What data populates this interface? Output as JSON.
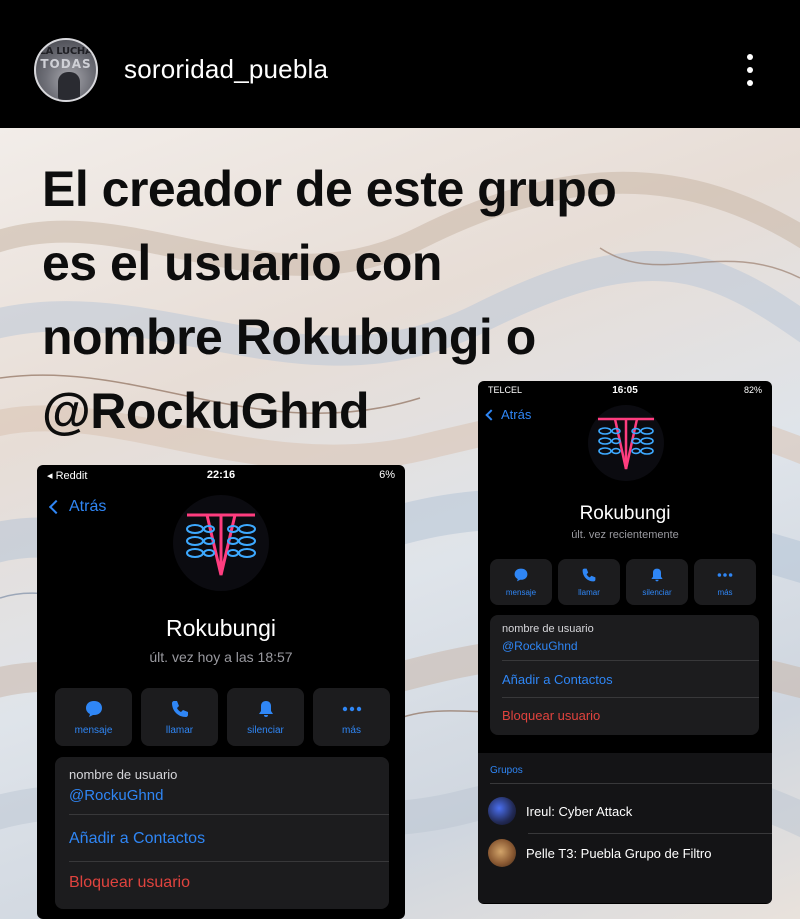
{
  "header": {
    "username": "sororidad_puebla",
    "avatar_text_line1": "LA LUCHA",
    "avatar_text_line2": "TODAS"
  },
  "headline": {
    "lines": [
      "El creador de este grupo",
      "es el usuario con",
      "nombre Rokubungi o",
      "@RockuGhnd"
    ]
  },
  "left_phone": {
    "status": {
      "carrier": "◂ Reddit",
      "time": "22:16",
      "battery": "6%"
    },
    "back_label": "Atrás",
    "name": "Rokubungi",
    "last_seen": "últ. vez hoy a las 18:57",
    "actions": [
      {
        "label": "mensaje",
        "icon": "chat-bubble-icon"
      },
      {
        "label": "llamar",
        "icon": "phone-icon"
      },
      {
        "label": "silenciar",
        "icon": "bell-icon"
      },
      {
        "label": "más",
        "icon": "more-icon"
      }
    ],
    "username_label": "nombre de usuario",
    "username_value": "@RockuGhnd",
    "add_contact": "Añadir a Contactos",
    "block_user": "Bloquear usuario"
  },
  "right_phone": {
    "status": {
      "carrier": "TELCEL",
      "time": "16:05",
      "battery": "82%"
    },
    "back_label": "Atrás",
    "name": "Rokubungi",
    "last_seen": "últ. vez recientemente",
    "actions": [
      {
        "label": "mensaje",
        "icon": "chat-bubble-icon"
      },
      {
        "label": "llamar",
        "icon": "phone-icon"
      },
      {
        "label": "silenciar",
        "icon": "bell-icon"
      },
      {
        "label": "más",
        "icon": "more-icon"
      }
    ],
    "username_label": "nombre de usuario",
    "username_value": "@RockuGhnd",
    "add_contact": "Añadir a Contactos",
    "block_user": "Bloquear usuario",
    "groups_title": "Grupos",
    "groups": [
      {
        "name": "Ireul: Cyber Attack"
      },
      {
        "name": "Pelle T3: Puebla Grupo de Filtro"
      }
    ]
  },
  "colors": {
    "accent_blue": "#2f86f5",
    "danger_red": "#e0433e",
    "card_bg": "#1c1c1e"
  }
}
